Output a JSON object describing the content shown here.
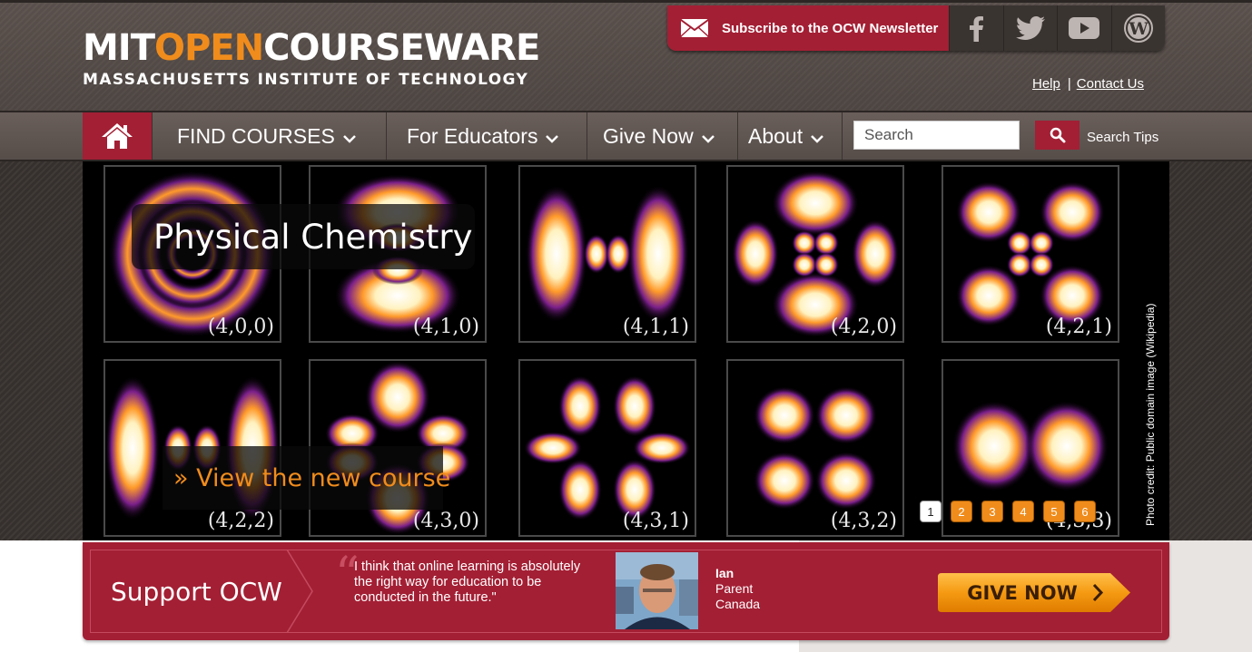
{
  "header": {
    "logo_mit": "MIT",
    "logo_open": "OPEN",
    "logo_courseware": "COURSEWARE",
    "logo_sub": "MASSACHUSETTS INSTITUTE OF TECHNOLOGY",
    "subscribe_label": "Subscribe to the OCW Newsletter",
    "social": [
      "facebook-icon",
      "twitter-icon",
      "youtube-icon",
      "wordpress-icon"
    ],
    "help_label": "Help",
    "separator": "|",
    "contact_label": "Contact Us"
  },
  "nav": {
    "home_icon": "home-icon",
    "items": [
      {
        "label": "FIND COURSES"
      },
      {
        "label": "For Educators"
      },
      {
        "label": "Give Now"
      },
      {
        "label": "About"
      }
    ],
    "search_placeholder": "Search",
    "search_tips": "Search Tips"
  },
  "hero": {
    "title": "Physical Chemistry",
    "link": "» View the new course",
    "credit": "Photo credit: Public domain image (Wikipedia)",
    "tiles": [
      {
        "label": "(4,0,0)"
      },
      {
        "label": "(4,1,0)"
      },
      {
        "label": "(4,1,1)"
      },
      {
        "label": "(4,2,0)"
      },
      {
        "label": "(4,2,1)"
      },
      {
        "label": "(4,2,2)"
      },
      {
        "label": "(4,3,0)"
      },
      {
        "label": "(4,3,1)"
      },
      {
        "label": "(4,3,2)"
      },
      {
        "label": "(4,3,3)"
      }
    ],
    "pages": [
      "1",
      "2",
      "3",
      "4",
      "5",
      "6"
    ],
    "active_page": "1"
  },
  "support": {
    "title": "Support OCW",
    "quote": "I think that online learning is absolutely the right way for education to be conducted in the future.\"",
    "person_name": "Ian",
    "person_role": "Parent",
    "person_country": "Canada",
    "give_label": "GIVE NOW"
  },
  "colors": {
    "accent": "#a31f34",
    "orange": "#f08c1c",
    "header_bg": "#554c48"
  }
}
